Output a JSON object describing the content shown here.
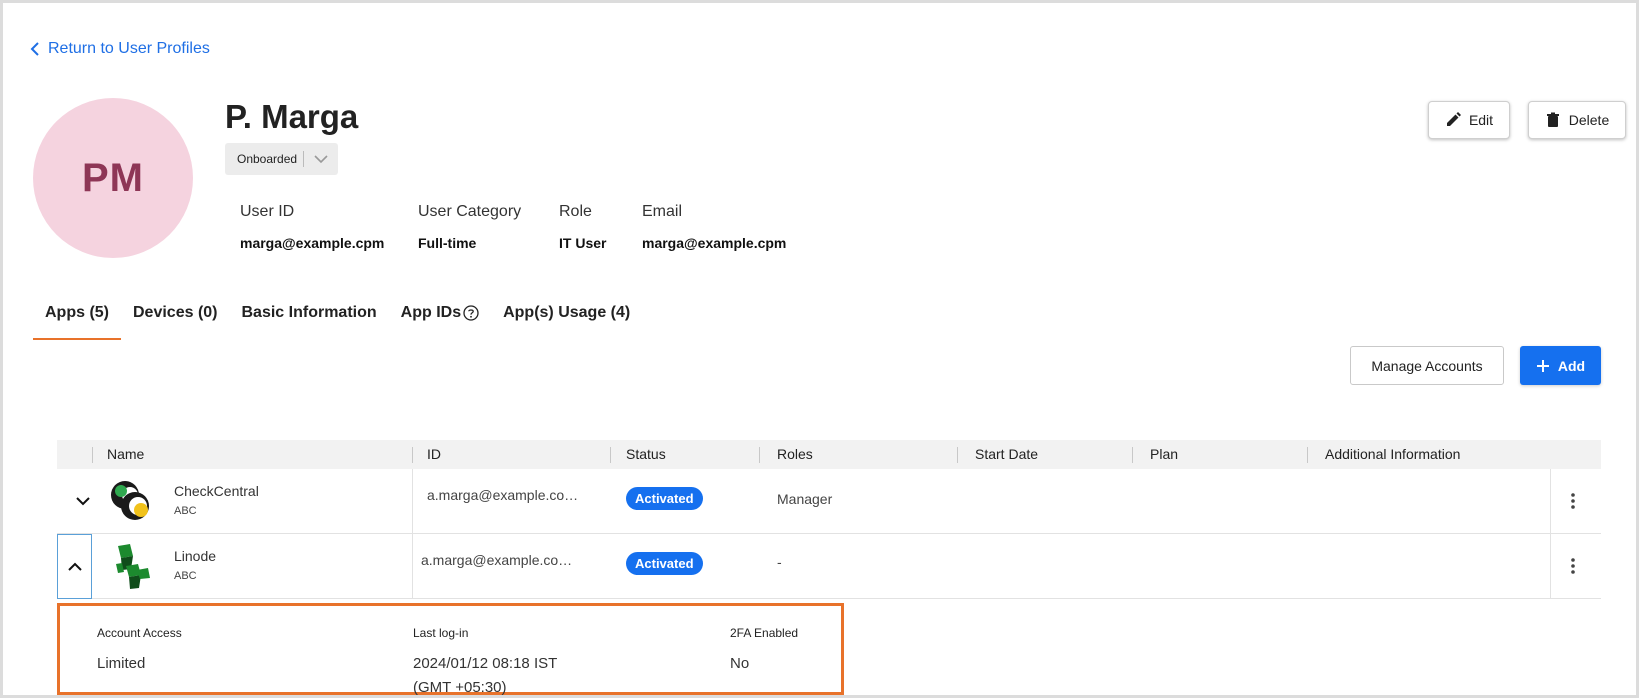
{
  "nav": {
    "back_label": "Return to User Profiles"
  },
  "profile": {
    "initials": "PM",
    "name": "P. Marga",
    "status": "Onboarded",
    "fields": [
      {
        "label": "User ID",
        "value": "marga@example.cpm"
      },
      {
        "label": "User Category",
        "value": "Full-time"
      },
      {
        "label": "Role",
        "value": "IT User"
      },
      {
        "label": "Email",
        "value": "marga@example.cpm"
      }
    ]
  },
  "actions": {
    "edit_label": "Edit",
    "delete_label": "Delete"
  },
  "tabs": [
    {
      "label": "Apps (5)",
      "active": true
    },
    {
      "label": "Devices (0)"
    },
    {
      "label": "Basic Information"
    },
    {
      "label": "App IDs"
    },
    {
      "label": "App(s) Usage (4)"
    }
  ],
  "toolbar": {
    "manage_label": "Manage Accounts",
    "add_label": "Add"
  },
  "table": {
    "columns": [
      "Name",
      "ID",
      "Status",
      "Roles",
      "Start Date",
      "Plan",
      "Additional Information"
    ],
    "rows": [
      {
        "name": "CheckCentral",
        "sub": "ABC",
        "id": "a.marga@example.co…",
        "status": "Activated",
        "roles": "Manager",
        "expanded": false,
        "icon": "checkcentral-logo"
      },
      {
        "name": "Linode",
        "sub": "ABC",
        "id": "a.marga@example.co…",
        "status": "Activated",
        "roles": "-",
        "expanded": true,
        "icon": "linode-logo"
      }
    ]
  },
  "details": {
    "items": [
      {
        "label": "Account Access",
        "value": "Limited"
      },
      {
        "label": "Last log-in",
        "value": "2024/01/12 08:18 IST",
        "value2": "(GMT +05:30)"
      },
      {
        "label": "2FA Enabled",
        "value": "No"
      }
    ]
  },
  "colors": {
    "accent": "#1570ef",
    "tab_underline": "#e8722a",
    "avatar_bg": "#f5d3df",
    "avatar_text": "#8e3656"
  }
}
